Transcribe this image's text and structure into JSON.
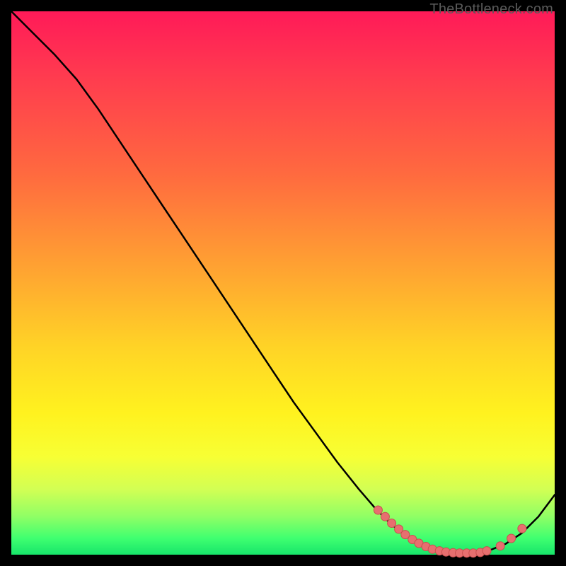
{
  "watermark": "TheBottleneck.com",
  "colors": {
    "page_bg": "#000000",
    "line": "#000000",
    "marker_fill": "#e76f6f",
    "marker_stroke": "#c94f4f"
  },
  "chart_data": {
    "type": "line",
    "title": "",
    "xlabel": "",
    "ylabel": "",
    "xlim": [
      0,
      100
    ],
    "ylim": [
      0,
      100
    ],
    "grid": false,
    "legend": false,
    "series": [
      {
        "name": "curve",
        "x": [
          0,
          4,
          8,
          12,
          16,
          20,
          24,
          28,
          32,
          36,
          40,
          44,
          48,
          52,
          56,
          60,
          64,
          67,
          70,
          73,
          76,
          79,
          82,
          85,
          88,
          91,
          94,
          97,
          100
        ],
        "y": [
          100,
          96,
          92,
          87.5,
          82,
          76,
          70,
          64,
          58,
          52,
          46,
          40,
          34,
          28,
          22.5,
          17,
          12,
          8.5,
          5.5,
          3.3,
          1.7,
          0.8,
          0.3,
          0.3,
          0.8,
          2.0,
          4.0,
          7.0,
          11.0
        ]
      }
    ],
    "markers": [
      {
        "x": 67.5,
        "y": 8.2
      },
      {
        "x": 68.8,
        "y": 7.0
      },
      {
        "x": 70.0,
        "y": 5.8
      },
      {
        "x": 71.3,
        "y": 4.7
      },
      {
        "x": 72.5,
        "y": 3.7
      },
      {
        "x": 73.8,
        "y": 2.8
      },
      {
        "x": 75.0,
        "y": 2.1
      },
      {
        "x": 76.3,
        "y": 1.5
      },
      {
        "x": 77.5,
        "y": 1.0
      },
      {
        "x": 78.8,
        "y": 0.7
      },
      {
        "x": 80.0,
        "y": 0.5
      },
      {
        "x": 81.3,
        "y": 0.35
      },
      {
        "x": 82.5,
        "y": 0.3
      },
      {
        "x": 83.8,
        "y": 0.3
      },
      {
        "x": 85.0,
        "y": 0.3
      },
      {
        "x": 86.3,
        "y": 0.4
      },
      {
        "x": 87.5,
        "y": 0.7
      },
      {
        "x": 90.0,
        "y": 1.6
      },
      {
        "x": 92.0,
        "y": 3.0
      },
      {
        "x": 94.0,
        "y": 4.8
      }
    ]
  }
}
